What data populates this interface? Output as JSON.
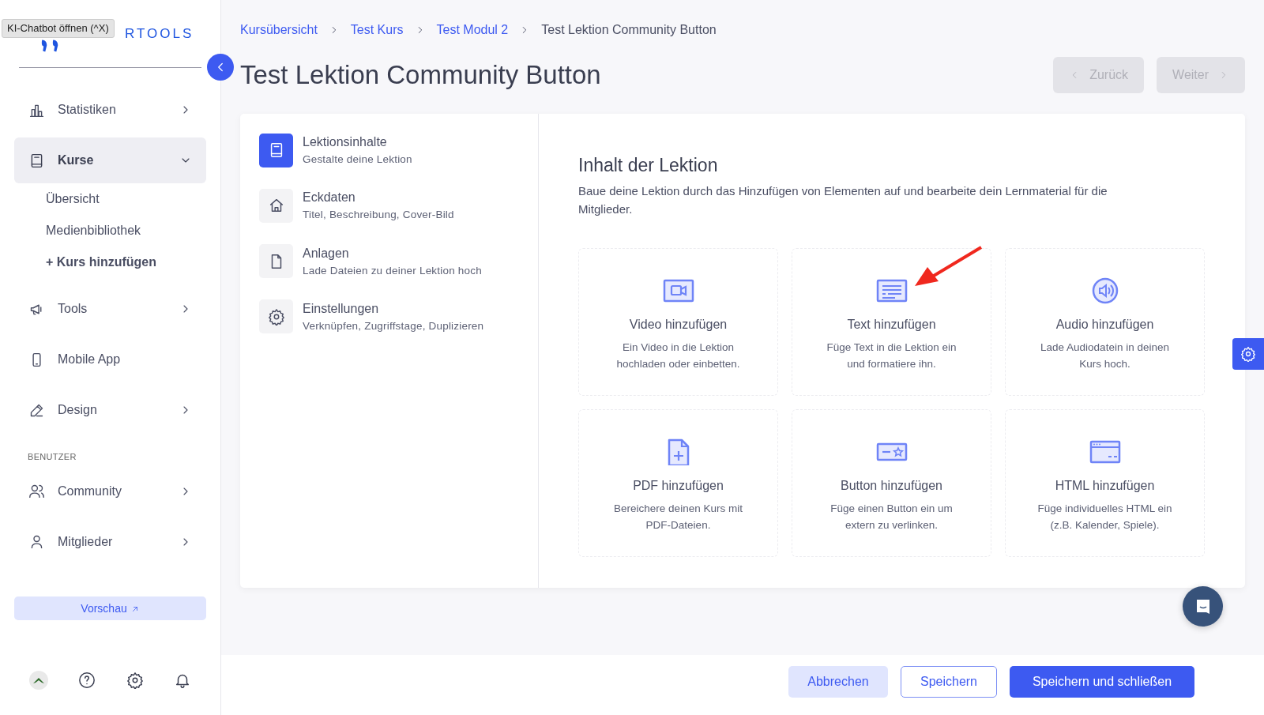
{
  "tooltip": "KI-Chatbot öffnen (^X)",
  "logo": "RTOOLS",
  "sidebar": {
    "items": [
      {
        "label": "Statistiken",
        "selected": false,
        "expanded": false
      },
      {
        "label": "Kurse",
        "selected": true,
        "expanded": true,
        "children": [
          {
            "label": "Übersicht",
            "kind": "link"
          },
          {
            "label": "Medienbibliothek",
            "kind": "link"
          },
          {
            "label": "+ Kurs hinzufügen",
            "kind": "add"
          }
        ]
      },
      {
        "label": "Tools",
        "selected": false,
        "expanded": false
      },
      {
        "label": "Mobile App",
        "selected": false
      },
      {
        "label": "Design",
        "selected": false,
        "expanded": false
      }
    ],
    "section": "BENUTZER",
    "section_items": [
      {
        "label": "Community",
        "selected": false,
        "expanded": false
      },
      {
        "label": "Mitglieder",
        "selected": false,
        "expanded": false
      }
    ],
    "preview_button": "Vorschau"
  },
  "breadcrumb": [
    {
      "label": "Kursübersicht",
      "current": false
    },
    {
      "label": "Test Kurs",
      "current": false
    },
    {
      "label": "Test Modul 2",
      "current": false
    },
    {
      "label": "Test Lektion Community Button",
      "current": true
    }
  ],
  "title": "Test Lektion Community Button",
  "nav_buttons": [
    {
      "label": "Zurück",
      "kind": "prev",
      "disabled": true
    },
    {
      "label": "Weiter",
      "kind": "next",
      "disabled": true
    }
  ],
  "steps": [
    {
      "title": "Lektionsinhalte",
      "subtitle": "Gestalte deine Lektion",
      "selected": true
    },
    {
      "title": "Eckdaten",
      "subtitle": "Titel, Beschreibung, Cover-Bild",
      "selected": false
    },
    {
      "title": "Anlagen",
      "subtitle": "Lade Dateien zu deiner Lektion hoch",
      "selected": false
    },
    {
      "title": "Einstellungen",
      "subtitle": "Verknüpfen, Zugriffstage, Duplizieren",
      "selected": false
    }
  ],
  "content": {
    "heading": "Inhalt der Lektion",
    "description": "Baue deine Lektion durch das Hinzufügen von Elementen auf und bearbeite dein Lernmaterial für die Mitglieder.",
    "elements": [
      {
        "title": "Video hinzufügen",
        "text": "Ein Video in die Lektion hochladen oder einbetten."
      },
      {
        "title": "Text hinzufügen",
        "text": "Füge Text in die Lektion ein und formatiere ihn."
      },
      {
        "title": "Audio hinzufügen",
        "text": "Lade Audiodatein in deinen Kurs hoch."
      },
      {
        "title": "PDF hinzufügen",
        "text": "Bereichere deinen Kurs mit PDF-Dateien."
      },
      {
        "title": "Button hinzufügen",
        "text": "Füge einen Button ein um extern zu verlinken."
      },
      {
        "title": "HTML hinzufügen",
        "text": "Füge individuelles HTML ein (z.B. Kalender, Spiele)."
      }
    ]
  },
  "footer_buttons": [
    {
      "label": "Abbrechen",
      "kind": "soft"
    },
    {
      "label": "Speichern",
      "kind": "outline"
    },
    {
      "label": "Speichern und schließen",
      "kind": "primary"
    }
  ]
}
